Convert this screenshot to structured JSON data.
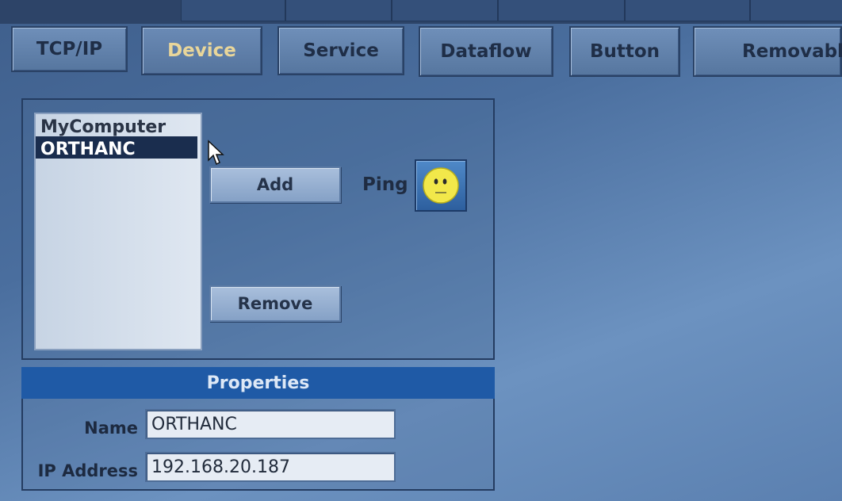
{
  "tabs": [
    {
      "label": "TCP/IP",
      "active": false
    },
    {
      "label": "Device",
      "active": true
    },
    {
      "label": "Service",
      "active": false
    },
    {
      "label": "Dataflow",
      "active": false
    },
    {
      "label": "Button",
      "active": false
    },
    {
      "label": "Removable",
      "active": false
    }
  ],
  "device_list": {
    "items": [
      {
        "label": "MyComputer",
        "selected": false
      },
      {
        "label": "ORTHANC",
        "selected": true
      }
    ]
  },
  "actions": {
    "add_label": "Add",
    "remove_label": "Remove",
    "ping_label": "Ping",
    "ping_status_icon": "neutral-face-icon"
  },
  "properties": {
    "title": "Properties",
    "name_label": "Name",
    "name_value": "ORTHANC",
    "ip_label": "IP Address",
    "ip_value": "192.168.20.187"
  },
  "colors": {
    "active_tab_text": "#e9d69a",
    "selection_bg": "#1a2d4e",
    "properties_header": "#1f5aa6",
    "ping_face": "#f2e84a"
  }
}
